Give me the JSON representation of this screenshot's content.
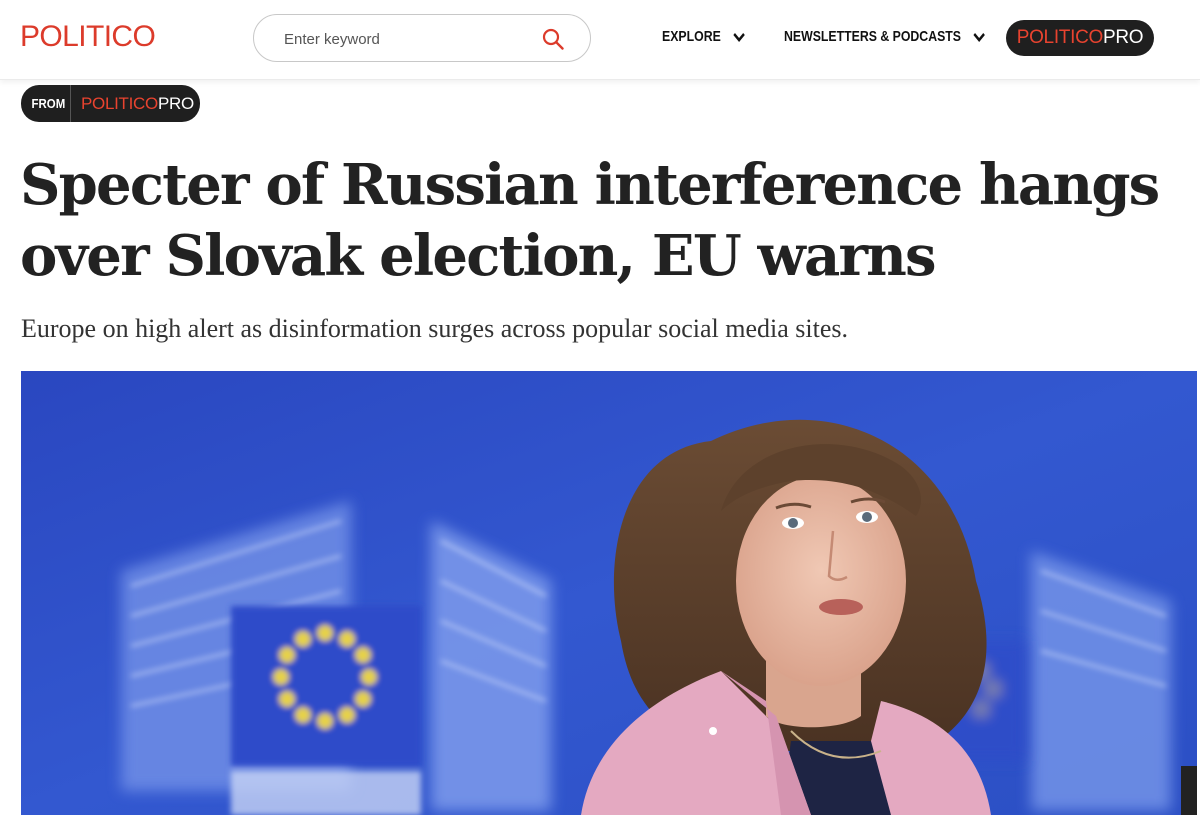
{
  "header": {
    "logo": "POLITICO",
    "search": {
      "placeholder": "Enter keyword",
      "value": ""
    },
    "nav": [
      {
        "label": "EXPLORE"
      },
      {
        "label": "NEWSLETTERS & PODCASTS"
      }
    ],
    "pro_button": {
      "brand": "POLITICO",
      "suffix": "PRO"
    }
  },
  "article": {
    "source_badge": {
      "from": "FROM",
      "brand": "POLITICO",
      "suffix": "PRO"
    },
    "headline": "Specter of Russian interference hangs over Slovak election, EU warns",
    "dek": "Europe on high alert as disinformation surges across popular social media sites.",
    "hero_image": {
      "description_icon": "photo-icon"
    }
  },
  "colors": {
    "brand_red": "#dc3b2b",
    "pill_dark": "#1f1f1f",
    "eu_blue": "#2f53c8"
  }
}
